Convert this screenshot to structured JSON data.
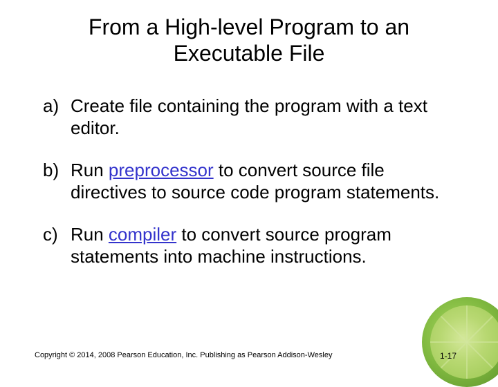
{
  "title": "From a High-level Program to an Executable File",
  "items": [
    {
      "marker": "a)",
      "parts": [
        {
          "text": "Create file containing the program with a text editor.",
          "link": false
        }
      ]
    },
    {
      "marker": "b)",
      "parts": [
        {
          "text": "Run ",
          "link": false
        },
        {
          "text": "preprocessor",
          "link": true
        },
        {
          "text": " to convert source file directives to source code program statements.",
          "link": false
        }
      ]
    },
    {
      "marker": "c)",
      "parts": [
        {
          "text": "Run ",
          "link": false
        },
        {
          "text": "compiler",
          "link": true
        },
        {
          "text": " to convert source program statements into machine instructions.",
          "link": false
        }
      ]
    }
  ],
  "copyright": "Copyright © 2014, 2008 Pearson Education, Inc. Publishing as Pearson Addison-Wesley",
  "page_number": "1-17"
}
